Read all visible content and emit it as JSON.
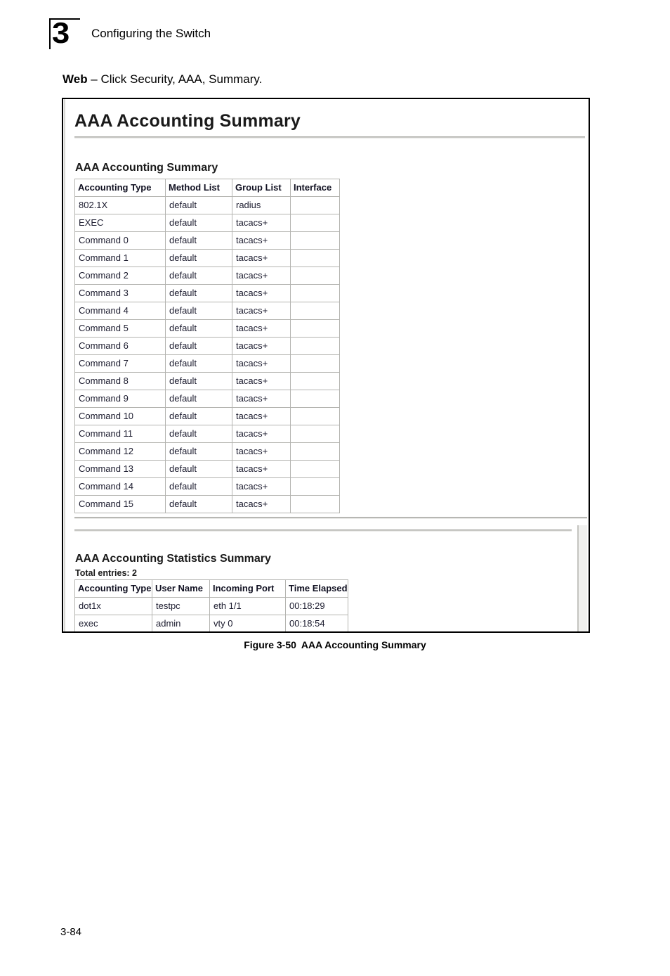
{
  "page": {
    "chapter_number": "3",
    "header_title": "Configuring the Switch",
    "footer_page": "3-84"
  },
  "instruction": {
    "label": "Web",
    "text": " – Click Security, AAA, Summary."
  },
  "screenshot": {
    "title": "AAA Accounting Summary",
    "summary_section": {
      "heading": "AAA Accounting Summary",
      "columns": [
        "Accounting Type",
        "Method List",
        "Group List",
        "Interface"
      ],
      "rows": [
        [
          "802.1X",
          "default",
          "radius",
          ""
        ],
        [
          "EXEC",
          "default",
          "tacacs+",
          ""
        ],
        [
          "Command 0",
          "default",
          "tacacs+",
          ""
        ],
        [
          "Command 1",
          "default",
          "tacacs+",
          ""
        ],
        [
          "Command 2",
          "default",
          "tacacs+",
          ""
        ],
        [
          "Command 3",
          "default",
          "tacacs+",
          ""
        ],
        [
          "Command 4",
          "default",
          "tacacs+",
          ""
        ],
        [
          "Command 5",
          "default",
          "tacacs+",
          ""
        ],
        [
          "Command 6",
          "default",
          "tacacs+",
          ""
        ],
        [
          "Command 7",
          "default",
          "tacacs+",
          ""
        ],
        [
          "Command 8",
          "default",
          "tacacs+",
          ""
        ],
        [
          "Command 9",
          "default",
          "tacacs+",
          ""
        ],
        [
          "Command 10",
          "default",
          "tacacs+",
          ""
        ],
        [
          "Command 11",
          "default",
          "tacacs+",
          ""
        ],
        [
          "Command 12",
          "default",
          "tacacs+",
          ""
        ],
        [
          "Command 13",
          "default",
          "tacacs+",
          ""
        ],
        [
          "Command 14",
          "default",
          "tacacs+",
          ""
        ],
        [
          "Command 15",
          "default",
          "tacacs+",
          ""
        ]
      ]
    },
    "stats_section": {
      "heading": "AAA Accounting Statistics Summary",
      "total_entries": "Total entries: 2",
      "columns": [
        "Accounting Type",
        "User Name",
        "Incoming Port",
        "Time Elapsed"
      ],
      "rows": [
        [
          "dot1x",
          "testpc",
          "eth 1/1",
          "00:18:29"
        ],
        [
          "exec",
          "admin",
          "vty 0",
          "00:18:54"
        ]
      ]
    }
  },
  "figure": {
    "number": "Figure 3-50",
    "title": "AAA Accounting Summary"
  }
}
